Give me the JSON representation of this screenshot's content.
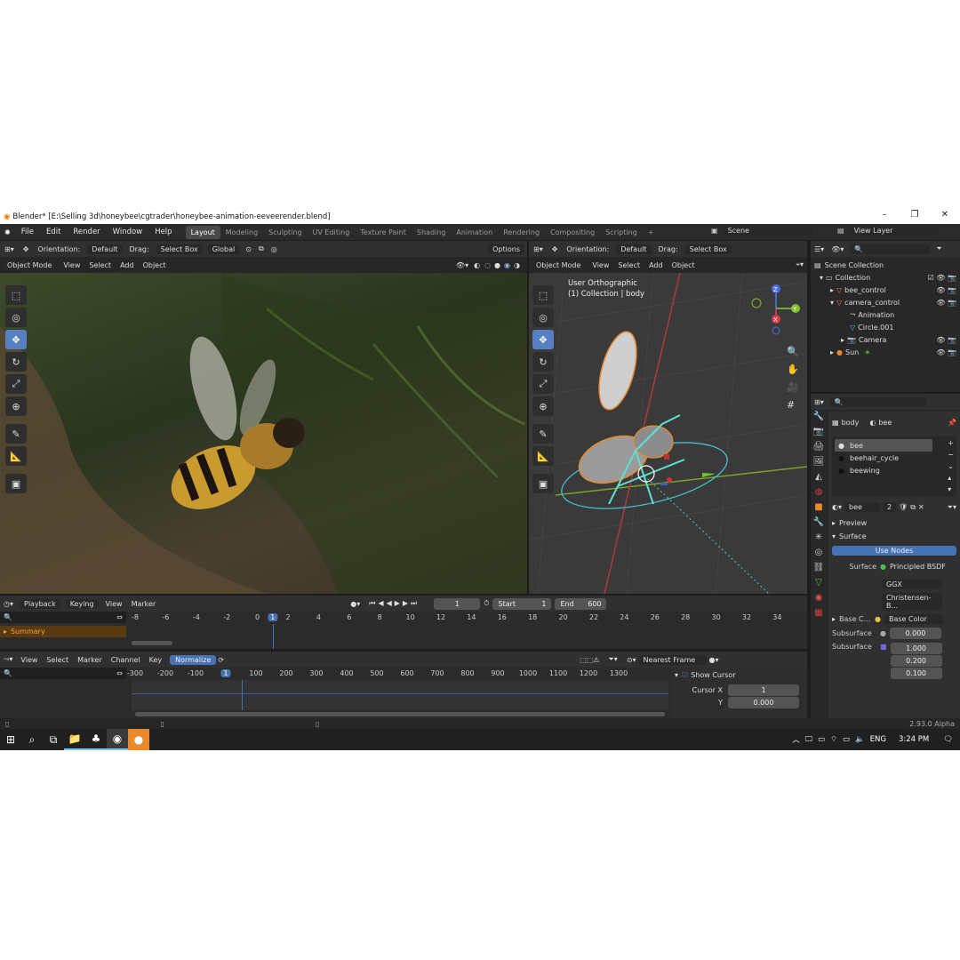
{
  "window": {
    "title": "Blender* [E:\\Selling 3d\\honeybee\\cgtrader\\honeybee-animation-eeveerender.blend]"
  },
  "menu": [
    "File",
    "Edit",
    "Render",
    "Window",
    "Help"
  ],
  "workspaces": [
    "Layout",
    "Modeling",
    "Sculpting",
    "UV Editing",
    "Texture Paint",
    "Shading",
    "Animation",
    "Rendering",
    "Compositing",
    "Scripting"
  ],
  "scene": {
    "name": "Scene",
    "view_layer": "View Layer"
  },
  "toolheader": {
    "orientation_label": "Orientation:",
    "orientation_value": "Default",
    "drag_label": "Drag:",
    "drag_value": "Select Box",
    "transform_value": "Global",
    "options": "Options"
  },
  "viewport_left": {
    "mode": "Object Mode",
    "menus": [
      "View",
      "Select",
      "Add",
      "Object"
    ]
  },
  "viewport_right": {
    "mode": "Object Mode",
    "menus": [
      "View",
      "Select",
      "Add",
      "Object"
    ],
    "overlay_line1": "User Orthographic",
    "overlay_line2": "(1) Collection | body",
    "gizmo": {
      "z": "Z",
      "y": "Y",
      "x": "X"
    }
  },
  "outliner": {
    "root": "Scene Collection",
    "items": [
      {
        "label": "Collection",
        "indent": 1
      },
      {
        "label": "bee_control",
        "indent": 2
      },
      {
        "label": "camera_control",
        "indent": 2
      },
      {
        "label": "Animation",
        "indent": 3
      },
      {
        "label": "Circle.001",
        "indent": 3
      },
      {
        "label": "Camera",
        "indent": 3
      },
      {
        "label": "Sun",
        "indent": 1
      }
    ]
  },
  "properties": {
    "breadcrumb_object": "body",
    "breadcrumb_material": "bee",
    "slots": [
      "bee",
      "beehair_cycle",
      "beewing"
    ],
    "material_name": "bee",
    "material_users": "2",
    "preview": "Preview",
    "surface_section": "Surface",
    "use_nodes": "Use Nodes",
    "surface_label": "Surface",
    "surface_value": "Principled BSDF",
    "distribution": "GGX",
    "subsurface_method": "Christensen-B...",
    "base_color_label": "Base C...",
    "base_color_value": "Base Color",
    "subsurface_label": "Subsurface",
    "subsurface_value": "0.000",
    "subsurface_radius_label": "Subsurface",
    "subsurface_radius": [
      "1.000",
      "0.200",
      "0.100"
    ]
  },
  "timeline": {
    "menus": [
      "Playback",
      "Keying",
      "View",
      "Marker"
    ],
    "current_frame": "1",
    "start_label": "Start",
    "start": "1",
    "end_label": "End",
    "end": "600",
    "ticks": [
      "-8",
      "-6",
      "-4",
      "-2",
      "0",
      "2",
      "4",
      "6",
      "8",
      "10",
      "12",
      "14",
      "16",
      "18",
      "20",
      "22",
      "24",
      "26",
      "28",
      "30",
      "32",
      "34"
    ],
    "cursor_label": "1",
    "summary": "Summary"
  },
  "graph": {
    "menus": [
      "View",
      "Select",
      "Marker",
      "Channel",
      "Key"
    ],
    "normalize": "Normalize",
    "snap": "Nearest Frame",
    "ticks": [
      "-300",
      "-200",
      "-100",
      "1",
      "100",
      "200",
      "300",
      "400",
      "500",
      "600",
      "700",
      "800",
      "900",
      "1000",
      "1100",
      "1200",
      "1300"
    ],
    "show_cursor": "Show Cursor",
    "cursor_x_label": "Cursor X",
    "cursor_x": "1",
    "cursor_y_label": "Y",
    "cursor_y": "0.000"
  },
  "status": {
    "version": "2.93.0 Alpha"
  },
  "taskbar": {
    "lang": "ENG",
    "time": "3:24 PM"
  }
}
